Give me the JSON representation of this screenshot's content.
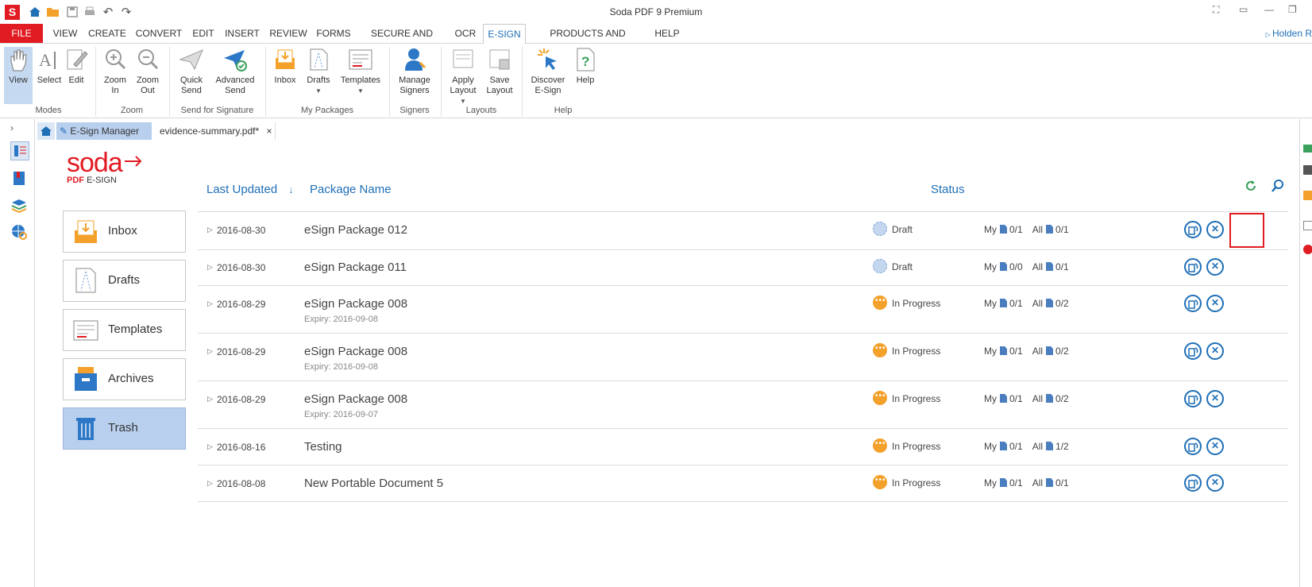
{
  "window": {
    "title": "Soda PDF 9 Premium",
    "app_logo": "S"
  },
  "menu": {
    "items": [
      "FILE",
      "VIEW",
      "CREATE",
      "CONVERT",
      "EDIT",
      "INSERT",
      "REVIEW",
      "FORMS",
      "SECURE AND SIGN",
      "OCR",
      "E-SIGN",
      "PRODUCTS AND PRICING",
      "HELP"
    ],
    "active": "E-SIGN",
    "user": "Holden R"
  },
  "ribbon": {
    "buttons": {
      "view": "View",
      "select": "Select",
      "edit": "Edit",
      "zoom_in_1": "Zoom",
      "zoom_in_2": "In",
      "zoom_out_1": "Zoom",
      "zoom_out_2": "Out",
      "quick_send_1": "Quick",
      "quick_send_2": "Send",
      "advanced_send_1": "Advanced",
      "advanced_send_2": "Send",
      "inbox": "Inbox",
      "drafts": "Drafts",
      "templates": "Templates",
      "manage_signers_1": "Manage",
      "manage_signers_2": "Signers",
      "apply_layout_1": "Apply",
      "apply_layout_2": "Layout",
      "save_layout_1": "Save",
      "save_layout_2": "Layout",
      "discover_1": "Discover",
      "discover_2": "E-Sign",
      "help": "Help"
    },
    "groups": {
      "modes": "Modes",
      "zoom": "Zoom",
      "send": "Send for Signature",
      "packages": "My Packages",
      "signers": "Signers",
      "layouts": "Layouts",
      "help": "Help"
    }
  },
  "tabs": {
    "manager": "E-Sign Manager",
    "document": "evidence-summary.pdf*",
    "close": "×"
  },
  "brand": {
    "logo": "soda",
    "sub_pdf": "PDF",
    "sub_esign": "E-SIGN",
    "accent": "#e11b22"
  },
  "nav": {
    "inbox": "Inbox",
    "drafts": "Drafts",
    "templates": "Templates",
    "archives": "Archives",
    "trash": "Trash"
  },
  "table": {
    "headers": {
      "last_updated": "Last Updated",
      "sort_arrow": "↓",
      "package_name": "Package Name",
      "status": "Status"
    },
    "my_label": "My",
    "all_label": "All",
    "rows": [
      {
        "date": "2016-08-30",
        "name": "eSign Package 012",
        "expiry": "",
        "status": "Draft",
        "my": "0/1",
        "all": "0/1"
      },
      {
        "date": "2016-08-30",
        "name": "eSign Package 011",
        "expiry": "",
        "status": "Draft",
        "my": "0/0",
        "all": "0/1"
      },
      {
        "date": "2016-08-29",
        "name": "eSign Package 008",
        "expiry": "Expiry: 2016-09-08",
        "status": "In Progress",
        "my": "0/1",
        "all": "0/2"
      },
      {
        "date": "2016-08-29",
        "name": "eSign Package 008",
        "expiry": "Expiry: 2016-09-08",
        "status": "In Progress",
        "my": "0/1",
        "all": "0/2"
      },
      {
        "date": "2016-08-29",
        "name": "eSign Package 008",
        "expiry": "Expiry: 2016-09-07",
        "status": "In Progress",
        "my": "0/1",
        "all": "0/2"
      },
      {
        "date": "2016-08-16",
        "name": "Testing",
        "expiry": "",
        "status": "In Progress",
        "my": "0/1",
        "all": "1/2"
      },
      {
        "date": "2016-08-08",
        "name": "New Portable Document 5",
        "expiry": "",
        "status": "In Progress",
        "my": "0/1",
        "all": "0/1"
      }
    ]
  },
  "colors": {
    "link_blue": "#1f6fb6",
    "draft": "#c5d7ee",
    "in_progress": "#f3a12b",
    "active_nav": "#b9cfee"
  }
}
